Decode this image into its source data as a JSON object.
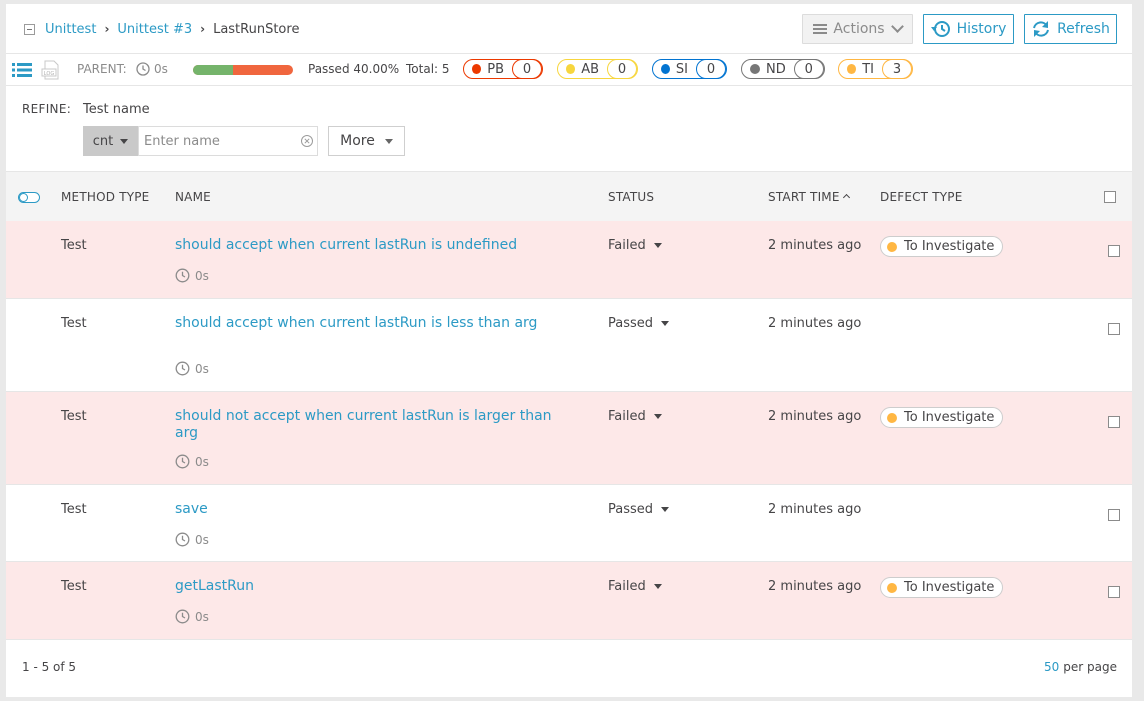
{
  "breadcrumbs": {
    "items": [
      "Unittest",
      "Unittest #3"
    ],
    "current": "LastRunStore"
  },
  "toolbar": {
    "actions_label": "Actions",
    "history_label": "History",
    "refresh_label": "Refresh",
    "icons": {
      "actions": "menu-icon",
      "history": "history-icon",
      "refresh": "refresh-icon"
    }
  },
  "info": {
    "parent_label": "PARENT:",
    "parent_duration": "0s",
    "passed_text": "Passed 40.00%",
    "passed_fraction": 0.4,
    "total_text": "Total:  5",
    "colors": {
      "passed": "#75b46b",
      "failed": "#f0663e"
    },
    "chips": [
      {
        "code": "PB",
        "count": "0",
        "color": "#ec3900",
        "key": "product-bug"
      },
      {
        "code": "AB",
        "count": "0",
        "color": "#f7d63e",
        "key": "automation-bug"
      },
      {
        "code": "SI",
        "count": "0",
        "color": "#0274d1",
        "key": "system-issue"
      },
      {
        "code": "ND",
        "count": "0",
        "color": "#777777",
        "key": "no-defect"
      },
      {
        "code": "TI",
        "count": "3",
        "color": "#ffb743",
        "key": "to-investigate"
      }
    ]
  },
  "refine": {
    "label": "REFINE:",
    "field_label": "Test name",
    "condition": "cnt",
    "placeholder": "Enter name",
    "more_label": "More"
  },
  "table": {
    "headers": {
      "method_type": "METHOD TYPE",
      "name": "NAME",
      "status": "STATUS",
      "start_time": "START TIME",
      "defect_type": "DEFECT TYPE"
    },
    "rows": [
      {
        "method": "Test",
        "name": "should accept when current lastRun is undefined",
        "duration": "0s",
        "status": "Failed",
        "start": "2 minutes ago",
        "defect": "To Investigate"
      },
      {
        "method": "Test",
        "name": "should accept when current lastRun is less than arg",
        "duration": "0s",
        "status": "Passed",
        "start": "2 minutes ago",
        "defect": ""
      },
      {
        "method": "Test",
        "name": "should not accept when current lastRun is larger than arg",
        "duration": "0s",
        "status": "Failed",
        "start": "2 minutes ago",
        "defect": "To Investigate"
      },
      {
        "method": "Test",
        "name": "save",
        "duration": "0s",
        "status": "Passed",
        "start": "2 minutes ago",
        "defect": ""
      },
      {
        "method": "Test",
        "name": "getLastRun",
        "duration": "0s",
        "status": "Failed",
        "start": "2 minutes ago",
        "defect": "To Investigate"
      }
    ]
  },
  "footer": {
    "count_text": "1 - 5 of 5",
    "per_page_value": "50",
    "per_page_label": "per page"
  }
}
